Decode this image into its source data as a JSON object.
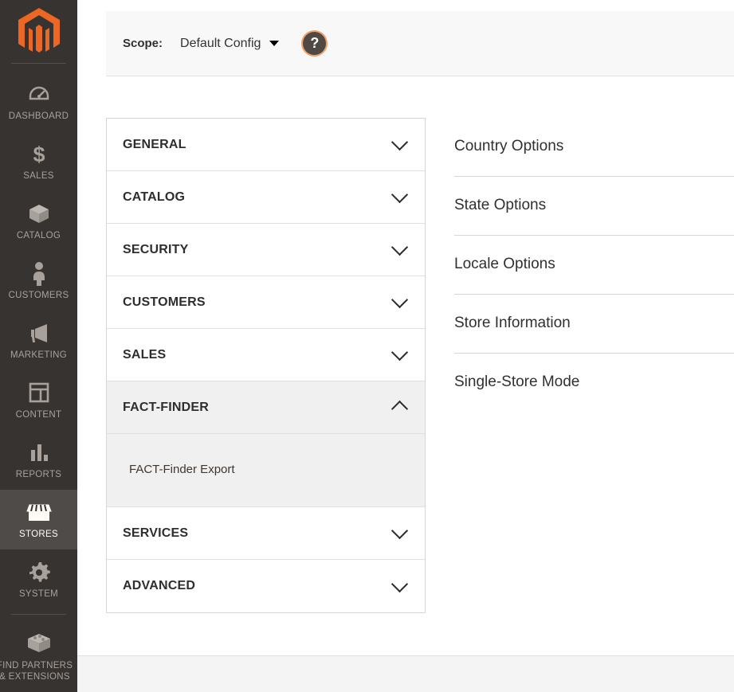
{
  "sidebar": {
    "logo": "magento-logo",
    "items": [
      {
        "label": "DASHBOARD",
        "icon": "dashboard-icon",
        "active": false
      },
      {
        "label": "SALES",
        "icon": "dollar-icon",
        "active": false
      },
      {
        "label": "CATALOG",
        "icon": "box-icon",
        "active": false
      },
      {
        "label": "CUSTOMERS",
        "icon": "person-icon",
        "active": false
      },
      {
        "label": "MARKETING",
        "icon": "megaphone-icon",
        "active": false
      },
      {
        "label": "CONTENT",
        "icon": "layout-icon",
        "active": false
      },
      {
        "label": "REPORTS",
        "icon": "bar-chart-icon",
        "active": false
      },
      {
        "label": "STORES",
        "icon": "storefront-icon",
        "active": true
      },
      {
        "label": "SYSTEM",
        "icon": "gear-icon",
        "active": false
      },
      {
        "label": "FIND PARTNERS & EXTENSIONS",
        "icon": "blocks-icon",
        "active": false
      }
    ]
  },
  "scope": {
    "label": "Scope:",
    "value": "Default Config",
    "caret": "chevron-down-icon",
    "help": "?"
  },
  "config_nav": {
    "sections": [
      {
        "title": "GENERAL",
        "open": false,
        "chevron": "chevron-down-icon",
        "items": []
      },
      {
        "title": "CATALOG",
        "open": false,
        "chevron": "chevron-down-icon",
        "items": []
      },
      {
        "title": "SECURITY",
        "open": false,
        "chevron": "chevron-down-icon",
        "items": []
      },
      {
        "title": "CUSTOMERS",
        "open": false,
        "chevron": "chevron-down-icon",
        "items": []
      },
      {
        "title": "SALES",
        "open": false,
        "chevron": "chevron-down-icon",
        "items": []
      },
      {
        "title": "FACT-FINDER",
        "open": true,
        "chevron": "chevron-up-icon",
        "items": [
          "FACT-Finder Export"
        ]
      },
      {
        "title": "SERVICES",
        "open": false,
        "chevron": "chevron-down-icon",
        "items": []
      },
      {
        "title": "ADVANCED",
        "open": false,
        "chevron": "chevron-down-icon",
        "items": []
      }
    ]
  },
  "config_content": {
    "fieldsets": [
      {
        "title": "Country Options"
      },
      {
        "title": "State Options"
      },
      {
        "title": "Locale Options"
      },
      {
        "title": "Store Information"
      },
      {
        "title": "Single-Store Mode"
      }
    ]
  },
  "colors": {
    "sidebar_bg": "#373330",
    "sidebar_active_bg": "#4f4b48",
    "brand_orange": "#ec6724",
    "scope_bar_bg": "#f8f8f8",
    "panel_open_bg": "#f0f0f0",
    "text_dark": "#303030"
  }
}
